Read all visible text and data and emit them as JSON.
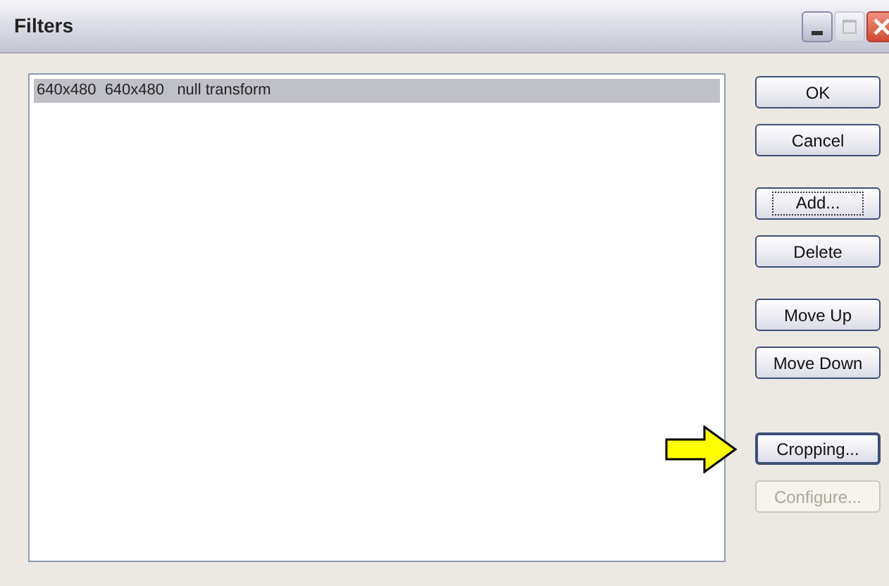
{
  "window": {
    "title": "Filters"
  },
  "filters": [
    {
      "text": "640x480  640x480   null transform",
      "selected": true
    }
  ],
  "button_groups": [
    [
      {
        "label": "OK",
        "disabled": false,
        "focused": false
      },
      {
        "label": "Cancel",
        "disabled": false,
        "focused": false
      }
    ],
    [
      {
        "label": "Add...",
        "disabled": false,
        "focused": true
      },
      {
        "label": "Delete",
        "disabled": false,
        "focused": false
      }
    ],
    [
      {
        "label": "Move Up",
        "disabled": false,
        "focused": false
      },
      {
        "label": "Move Down",
        "disabled": false,
        "focused": false
      }
    ],
    [
      {
        "label": "Cropping...",
        "disabled": false,
        "focused": false
      },
      {
        "label": "Configure...",
        "disabled": true,
        "focused": false
      }
    ]
  ]
}
